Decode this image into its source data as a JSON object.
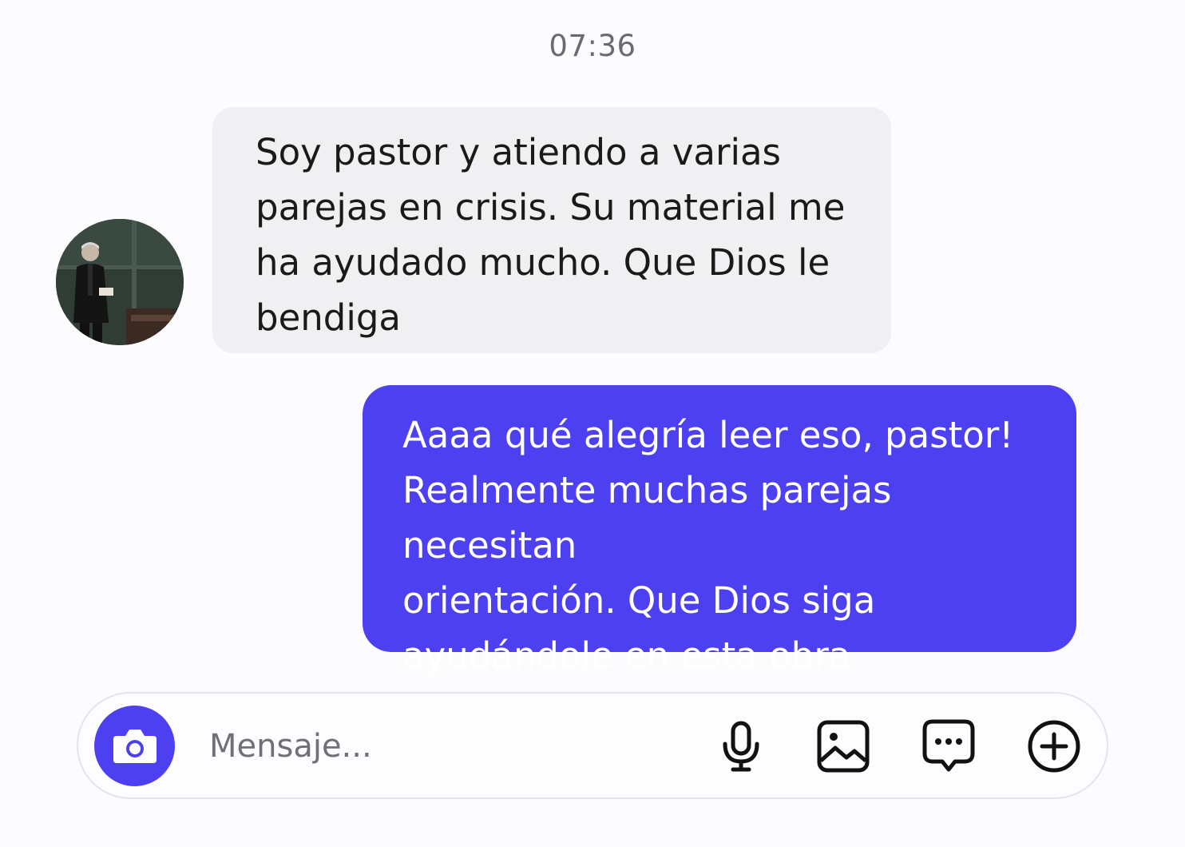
{
  "chat": {
    "timestamp": "07:36",
    "messages": [
      {
        "direction": "incoming",
        "text": "Soy pastor y atiendo a varias\nparejas en crisis. Su material me\nha ayudado mucho. Que Dios le\nbendiga"
      },
      {
        "direction": "outgoing",
        "text": "Aaaa qué alegría leer eso, pastor!\nRealmente muchas parejas necesitan\norientación. Que Dios siga\nayudándole en esta obra"
      }
    ]
  },
  "composer": {
    "placeholder": "Mensaje...",
    "value": "",
    "icons": [
      "camera-icon",
      "microphone-icon",
      "image-icon",
      "sticker-chat-icon",
      "plus-circle-icon"
    ]
  },
  "colors": {
    "accent": "#4d40f0",
    "incoming_bubble": "#f0f0f3",
    "background": "#fcfcfe"
  }
}
